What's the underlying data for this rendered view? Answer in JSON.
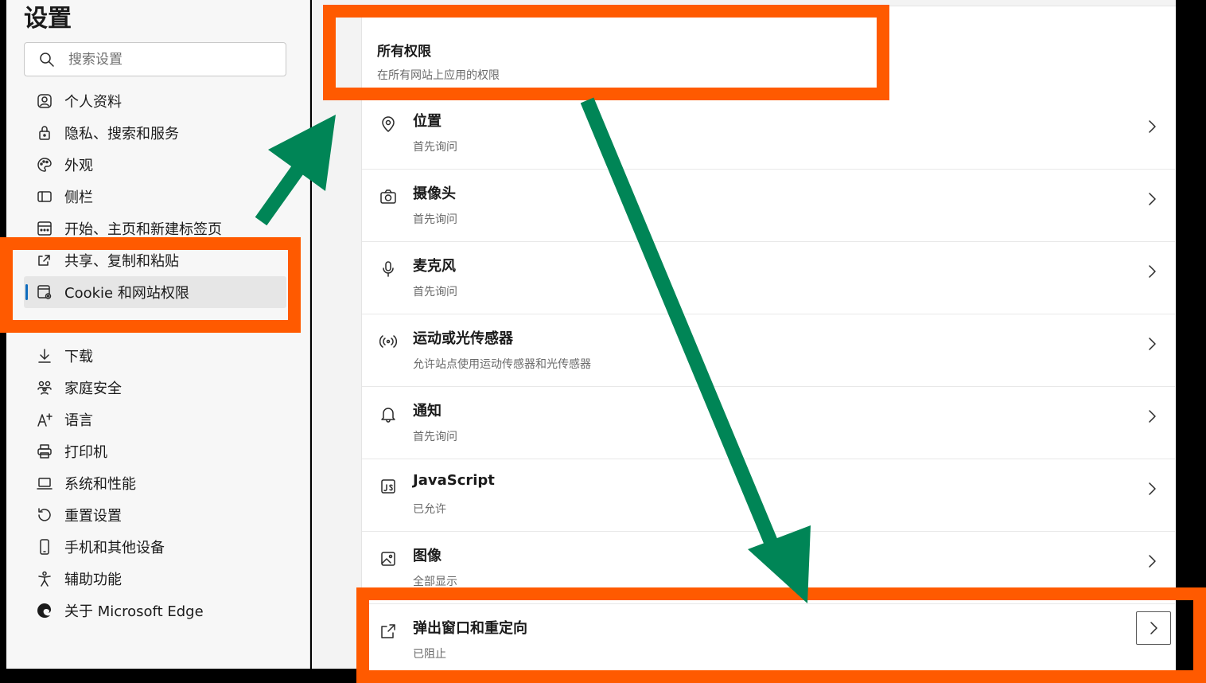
{
  "sidebar": {
    "title": "设置",
    "search_placeholder": "搜索设置",
    "items": [
      {
        "label": "个人资料",
        "icon": "profile-icon"
      },
      {
        "label": "隐私、搜索和服务",
        "icon": "lock-icon"
      },
      {
        "label": "外观",
        "icon": "palette-icon"
      },
      {
        "label": "侧栏",
        "icon": "sidebar-icon"
      },
      {
        "label": "开始、主页和新建标签页",
        "icon": "home-tab-icon"
      },
      {
        "label": "共享、复制和粘贴",
        "icon": "share-icon"
      },
      {
        "label": "Cookie 和网站权限",
        "icon": "cookie-settings-icon",
        "active": true
      },
      {
        "label": "下载",
        "icon": "download-icon"
      },
      {
        "label": "家庭安全",
        "icon": "family-icon"
      },
      {
        "label": "语言",
        "icon": "language-icon"
      },
      {
        "label": "打印机",
        "icon": "printer-icon"
      },
      {
        "label": "系统和性能",
        "icon": "laptop-icon"
      },
      {
        "label": "重置设置",
        "icon": "reset-icon"
      },
      {
        "label": "手机和其他设备",
        "icon": "phone-icon"
      },
      {
        "label": "辅助功能",
        "icon": "accessibility-icon"
      },
      {
        "label": "关于 Microsoft Edge",
        "icon": "edge-logo-icon"
      }
    ]
  },
  "main": {
    "all_permissions": {
      "title": "所有权限",
      "subtitle": "在所有网站上应用的权限"
    },
    "permissions": [
      {
        "title": "位置",
        "subtitle": "首先询问",
        "icon": "location-icon"
      },
      {
        "title": "摄像头",
        "subtitle": "首先询问",
        "icon": "camera-icon"
      },
      {
        "title": "麦克风",
        "subtitle": "首先询问",
        "icon": "microphone-icon"
      },
      {
        "title": "运动或光传感器",
        "subtitle": "允许站点使用运动传感器和光传感器",
        "icon": "sensor-icon"
      },
      {
        "title": "通知",
        "subtitle": "首先询问",
        "icon": "bell-icon"
      },
      {
        "title": "JavaScript",
        "subtitle": "已允许",
        "icon": "javascript-icon"
      },
      {
        "title": "图像",
        "subtitle": "全部显示",
        "icon": "image-icon"
      },
      {
        "title": "弹出窗口和重定向",
        "subtitle": "已阻止",
        "icon": "popup-icon"
      }
    ]
  },
  "colors": {
    "highlight": "#ff5a00",
    "arrow": "#008556",
    "active_indicator": "#0f6cbd"
  }
}
